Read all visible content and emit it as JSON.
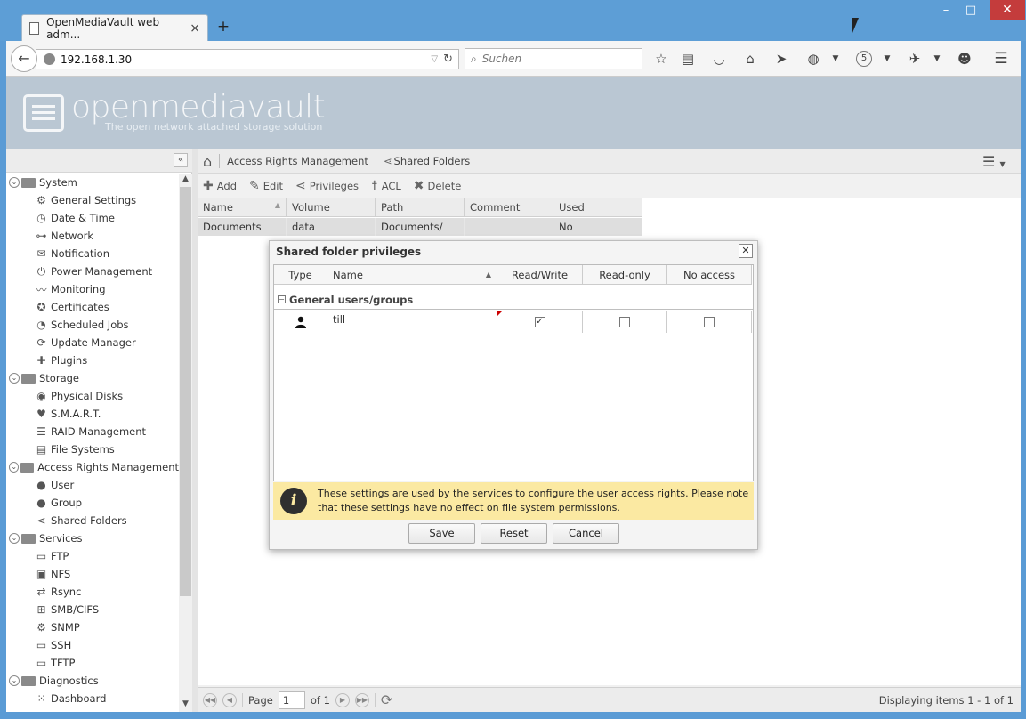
{
  "browser": {
    "tab_title": "OpenMediaVault web adm...",
    "tab_close": "×",
    "new_tab": "+",
    "url": "192.168.1.30",
    "search_placeholder": "Suchen",
    "badge_count": "5",
    "win_minimize": "–",
    "win_maximize": "□",
    "win_close": "✕"
  },
  "app": {
    "logo_text": "openmediavault",
    "logo_subtitle": "The open network attached storage solution"
  },
  "sidebar": {
    "collapse": "«",
    "tree": [
      {
        "type": "group",
        "label": "System",
        "icon": "folder-icon"
      },
      {
        "type": "leaf",
        "label": "General Settings",
        "icon": "gears-icon",
        "glyph": "⚙"
      },
      {
        "type": "leaf",
        "label": "Date & Time",
        "icon": "clock-icon",
        "glyph": "◷"
      },
      {
        "type": "leaf",
        "label": "Network",
        "icon": "network-icon",
        "glyph": "⊶"
      },
      {
        "type": "leaf",
        "label": "Notification",
        "icon": "envelope-icon",
        "glyph": "✉"
      },
      {
        "type": "leaf",
        "label": "Power Management",
        "icon": "power-icon",
        "glyph": "⏻"
      },
      {
        "type": "leaf",
        "label": "Monitoring",
        "icon": "chart-icon",
        "glyph": "〰"
      },
      {
        "type": "leaf",
        "label": "Certificates",
        "icon": "certificate-icon",
        "glyph": "✪"
      },
      {
        "type": "leaf",
        "label": "Scheduled Jobs",
        "icon": "schedule-icon",
        "glyph": "◔"
      },
      {
        "type": "leaf",
        "label": "Update Manager",
        "icon": "update-icon",
        "glyph": "⟳"
      },
      {
        "type": "leaf",
        "label": "Plugins",
        "icon": "puzzle-icon",
        "glyph": "✚"
      },
      {
        "type": "group",
        "label": "Storage",
        "icon": "folder-icon"
      },
      {
        "type": "leaf",
        "label": "Physical Disks",
        "icon": "disk-icon",
        "glyph": "◉"
      },
      {
        "type": "leaf",
        "label": "S.M.A.R.T.",
        "icon": "smart-icon",
        "glyph": "♥"
      },
      {
        "type": "leaf",
        "label": "RAID Management",
        "icon": "raid-icon",
        "glyph": "☰"
      },
      {
        "type": "leaf",
        "label": "File Systems",
        "icon": "filesystem-icon",
        "glyph": "▤"
      },
      {
        "type": "group",
        "label": "Access Rights Management",
        "icon": "folder-icon"
      },
      {
        "type": "leaf",
        "label": "User",
        "icon": "user-icon",
        "glyph": "●"
      },
      {
        "type": "leaf",
        "label": "Group",
        "icon": "group-icon",
        "glyph": "●"
      },
      {
        "type": "leaf",
        "label": "Shared Folders",
        "icon": "share-icon",
        "glyph": "⋖"
      },
      {
        "type": "group",
        "label": "Services",
        "icon": "folder-icon"
      },
      {
        "type": "leaf",
        "label": "FTP",
        "icon": "ftp-icon",
        "glyph": "▭"
      },
      {
        "type": "leaf",
        "label": "NFS",
        "icon": "nfs-icon",
        "glyph": "▣"
      },
      {
        "type": "leaf",
        "label": "Rsync",
        "icon": "rsync-icon",
        "glyph": "⇄"
      },
      {
        "type": "leaf",
        "label": "SMB/CIFS",
        "icon": "windows-icon",
        "glyph": "⊞"
      },
      {
        "type": "leaf",
        "label": "SNMP",
        "icon": "snmp-icon",
        "glyph": "⚙"
      },
      {
        "type": "leaf",
        "label": "SSH",
        "icon": "terminal-icon",
        "glyph": "▭"
      },
      {
        "type": "leaf",
        "label": "TFTP",
        "icon": "tftp-icon",
        "glyph": "▭"
      },
      {
        "type": "group",
        "label": "Diagnostics",
        "icon": "folder-icon"
      },
      {
        "type": "leaf",
        "label": "Dashboard",
        "icon": "dashboard-icon",
        "glyph": "⁙"
      }
    ]
  },
  "breadcrumb": {
    "home": "⌂",
    "items": [
      "Access Rights Management",
      "Shared Folders"
    ]
  },
  "toolbar": {
    "add": "Add",
    "edit": "Edit",
    "privileges": "Privileges",
    "acl": "ACL",
    "delete": "Delete"
  },
  "grid": {
    "columns": [
      "Name",
      "Volume",
      "Path",
      "Comment",
      "Used"
    ],
    "rows": [
      [
        "Documents",
        "data",
        "Documents/",
        "",
        "No"
      ]
    ]
  },
  "pager": {
    "page_label": "Page",
    "page_value": "1",
    "of_label": "of 1",
    "display": "Displaying items 1 - 1 of 1"
  },
  "dialog": {
    "title": "Shared folder privileges",
    "close": "✕",
    "columns": [
      "Type",
      "Name",
      "Read/Write",
      "Read-only",
      "No access"
    ],
    "group_label": "General users/groups",
    "group_toggle": "−",
    "rows": [
      {
        "name": "till",
        "read_write": true,
        "read_only": false,
        "no_access": false
      }
    ],
    "info": "These settings are used by the services to configure the user access rights. Please note that these settings have no effect on file system permissions.",
    "info_glyph": "i",
    "save": "Save",
    "reset": "Reset",
    "cancel": "Cancel"
  }
}
